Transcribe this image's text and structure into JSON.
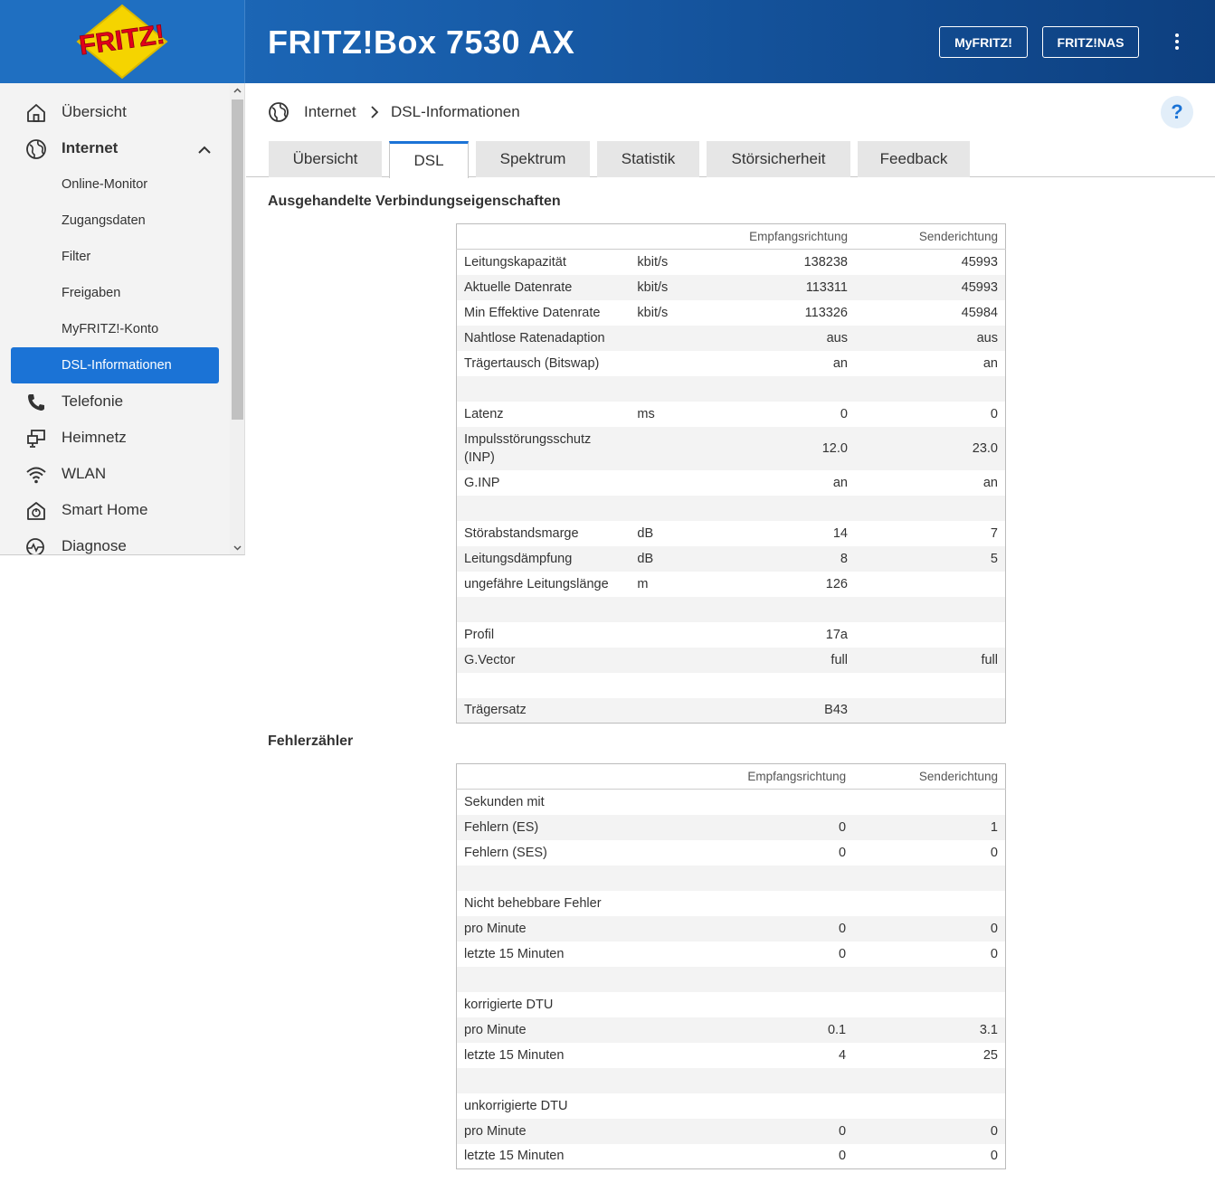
{
  "header": {
    "product": "FRITZ!Box 7530 AX",
    "myfritz_label": "MyFRITZ!",
    "nas_label": "FRITZ!NAS",
    "logo_text": "FRITZ!"
  },
  "sidebar": {
    "items": [
      {
        "label": "Übersicht",
        "icon": "home-icon"
      },
      {
        "label": "Internet",
        "icon": "globe-icon"
      },
      {
        "label": "Online-Monitor"
      },
      {
        "label": "Zugangsdaten"
      },
      {
        "label": "Filter"
      },
      {
        "label": "Freigaben"
      },
      {
        "label": "MyFRITZ!-Konto"
      },
      {
        "label": "DSL-Informationen"
      },
      {
        "label": "Telefonie",
        "icon": "phone-icon"
      },
      {
        "label": "Heimnetz",
        "icon": "network-icon"
      },
      {
        "label": "WLAN",
        "icon": "wifi-icon"
      },
      {
        "label": "Smart Home",
        "icon": "smarthome-icon"
      },
      {
        "label": "Diagnose",
        "icon": "diagnose-icon"
      }
    ]
  },
  "breadcrumb": {
    "level1": "Internet",
    "level2": "DSL-Informationen"
  },
  "help_label": "?",
  "tabs": [
    "Übersicht",
    "DSL",
    "Spektrum",
    "Statistik",
    "Störsicherheit",
    "Feedback"
  ],
  "active_tab": "DSL",
  "connection": {
    "title": "Ausgehandelte Verbindungseigenschaften",
    "col_rx": "Empfangsrichtung",
    "col_tx": "Senderichtung",
    "rows": [
      [
        "Leitungskapazität",
        "kbit/s",
        "138238",
        "45993"
      ],
      [
        "Aktuelle Datenrate",
        "kbit/s",
        "113311",
        "45993"
      ],
      [
        "Min Effektive Datenrate",
        "kbit/s",
        "113326",
        "45984"
      ],
      [
        "Nahtlose Ratenadaption",
        "",
        "aus",
        "aus"
      ],
      [
        "Trägertausch (Bitswap)",
        "",
        "an",
        "an"
      ],
      [
        "",
        "",
        "",
        ""
      ],
      [
        "Latenz",
        "ms",
        "0",
        "0"
      ],
      [
        "Impulsstörungsschutz (INP)",
        "",
        "12.0",
        "23.0"
      ],
      [
        "G.INP",
        "",
        "an",
        "an"
      ],
      [
        "",
        "",
        "",
        ""
      ],
      [
        "Störabstandsmarge",
        "dB",
        "14",
        "7"
      ],
      [
        "Leitungsdämpfung",
        "dB",
        "8",
        "5"
      ],
      [
        "ungefähre Leitungslänge",
        "m",
        "126",
        ""
      ],
      [
        "",
        "",
        "",
        ""
      ],
      [
        "Profil",
        "",
        "17a",
        ""
      ],
      [
        "G.Vector",
        "",
        "full",
        "full"
      ],
      [
        "",
        "",
        "",
        ""
      ],
      [
        "Trägersatz",
        "",
        "B43",
        ""
      ]
    ]
  },
  "errors": {
    "title": "Fehlerzähler",
    "col_rx": "Empfangsrichtung",
    "col_tx": "Senderichtung",
    "rows": [
      [
        "Sekunden mit",
        "",
        "",
        ""
      ],
      [
        "Fehlern (ES)",
        "",
        "0",
        "1"
      ],
      [
        "Fehlern (SES)",
        "",
        "0",
        "0"
      ],
      [
        "",
        "",
        "",
        ""
      ],
      [
        "Nicht behebbare Fehler",
        "",
        "",
        ""
      ],
      [
        "pro Minute",
        "",
        "0",
        "0"
      ],
      [
        "letzte 15 Minuten",
        "",
        "0",
        "0"
      ],
      [
        "",
        "",
        "",
        ""
      ],
      [
        "korrigierte DTU",
        "",
        "",
        ""
      ],
      [
        "pro Minute",
        "",
        "0.1",
        "3.1"
      ],
      [
        "letzte 15 Minuten",
        "",
        "4",
        "25"
      ],
      [
        "",
        "",
        "",
        ""
      ],
      [
        "unkorrigierte DTU",
        "",
        "",
        ""
      ],
      [
        "pro Minute",
        "",
        "0",
        "0"
      ],
      [
        "letzte 15 Minuten",
        "",
        "0",
        "0"
      ]
    ]
  },
  "colors": {
    "accent": "#1b73d6",
    "header": "#1f6fc1",
    "logo_red": "#e2001a",
    "logo_yellow": "#f5d400"
  }
}
